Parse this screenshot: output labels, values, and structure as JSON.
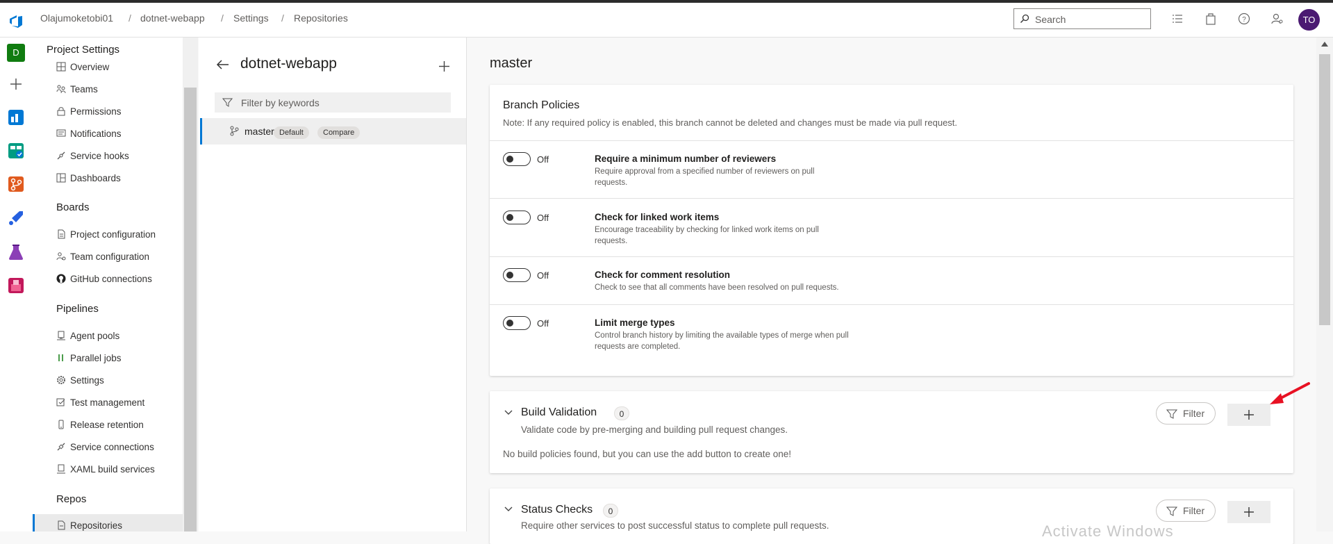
{
  "breadcrumb": [
    "Olajumoketobi01",
    "dotnet-webapp",
    "Settings",
    "Repositories"
  ],
  "search": {
    "placeholder": "Search"
  },
  "user": {
    "initials": "TO"
  },
  "rail": {
    "project_initial": "D"
  },
  "nav": {
    "title": "Project Settings",
    "general_items": [
      "Overview",
      "Teams",
      "Permissions",
      "Notifications",
      "Service hooks",
      "Dashboards"
    ],
    "boards": {
      "header": "Boards",
      "items": [
        "Project configuration",
        "Team configuration",
        "GitHub connections"
      ]
    },
    "pipelines": {
      "header": "Pipelines",
      "items": [
        "Agent pools",
        "Parallel jobs",
        "Settings",
        "Test management",
        "Release retention",
        "Service connections",
        "XAML build services"
      ]
    },
    "repos": {
      "header": "Repos",
      "items": [
        "Repositories"
      ]
    }
  },
  "repo": {
    "name": "dotnet-webapp",
    "filter_placeholder": "Filter by keywords",
    "branch": {
      "name": "master",
      "default_badge": "Default",
      "compare_badge": "Compare"
    }
  },
  "main": {
    "branch_title": "master",
    "branch_policies": {
      "title": "Branch Policies",
      "note": "Note: If any required policy is enabled, this branch cannot be deleted and changes must be made via pull request.",
      "off_label": "Off",
      "policies": [
        {
          "title": "Require a minimum number of reviewers",
          "desc": "Require approval from a specified number of reviewers on pull requests.",
          "enabled": false
        },
        {
          "title": "Check for linked work items",
          "desc": "Encourage traceability by checking for linked work items on pull requests.",
          "enabled": false
        },
        {
          "title": "Check for comment resolution",
          "desc": "Check to see that all comments have been resolved on pull requests.",
          "enabled": false
        },
        {
          "title": "Limit merge types",
          "desc": "Control branch history by limiting the available types of merge when pull requests are completed.",
          "enabled": false
        }
      ]
    },
    "build_validation": {
      "title": "Build Validation",
      "count": "0",
      "desc": "Validate code by pre-merging and building pull request changes.",
      "empty": "No build policies found, but you can use the add button to create one!",
      "filter_label": "Filter"
    },
    "status_checks": {
      "title": "Status Checks",
      "count": "0",
      "desc": "Require other services to post successful status to complete pull requests.",
      "filter_label": "Filter"
    }
  },
  "watermark": "Activate Windows",
  "colors": {
    "accent": "#0078d4",
    "arrow": "#e81123",
    "avatar": "#4b1a72"
  }
}
